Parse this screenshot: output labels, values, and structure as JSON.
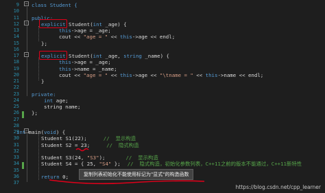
{
  "line_numbers": [
    "9",
    "10",
    "11",
    "12",
    "13",
    "14",
    "15",
    "16",
    "17",
    "18",
    "19",
    "20",
    "21",
    "22",
    "23",
    "24",
    "25",
    "26",
    "27",
    "28",
    "29",
    "30",
    "31",
    "32",
    "33",
    "34",
    "35",
    "36",
    "37"
  ],
  "code": {
    "l9": [
      "class Student {"
    ],
    "l11": [
      "public:"
    ],
    "l12": [
      "explicit",
      " Student(",
      "int",
      " _age) {"
    ],
    "l13": [
      "this",
      "->age = _age;"
    ],
    "l14": [
      "cout << ",
      "\"age = \"",
      " << ",
      "this",
      "->age << endl;"
    ],
    "l15": [
      "};"
    ],
    "l17": [
      "explicit",
      " Student(",
      "int",
      " _age, ",
      "string",
      " _name) {"
    ],
    "l18": [
      "this",
      "->age = _age;"
    ],
    "l19": [
      "this",
      "->name = _name;"
    ],
    "l20": [
      "cout << ",
      "\"age = \"",
      " << ",
      "this",
      "->age << ",
      "\"\\tname = \"",
      " << ",
      "this",
      "->name << endl;"
    ],
    "l21": [
      "}"
    ],
    "l23": [
      "private:"
    ],
    "l24": [
      "int",
      " age;"
    ],
    "l25": [
      "string name;"
    ],
    "l26": [
      "};"
    ],
    "l29": [
      "int",
      " main(",
      "void",
      ") {"
    ],
    "l30": [
      "Student S1(22);",
      "//  显示构造"
    ],
    "l31": [
      "Student S2 = ",
      "23",
      ";",
      "//  隐式构造"
    ],
    "l33": [
      "Student S3(24, ",
      "\"S3\"",
      ");",
      "//  显示构造"
    ],
    "l34": [
      "Student S4 = { 25, ",
      "\"S4\"",
      " };",
      "//  隐式构造，初始化参数列表，C++11之前的版本不能通过，C++11新特性"
    ],
    "l36": [
      "return",
      " 0;"
    ]
  },
  "tooltip": "复制列表初始化不能使用标记为\"显式\"的构造函数",
  "watermark": "https://blog.csdn.net/cpp_learner",
  "colors": {
    "background": "#1e1e1e",
    "keyword": "#569cd6",
    "string": "#d69d85",
    "comment": "#57a64a",
    "line_number": "#2b91af",
    "highlight_box": "#e0001a"
  }
}
